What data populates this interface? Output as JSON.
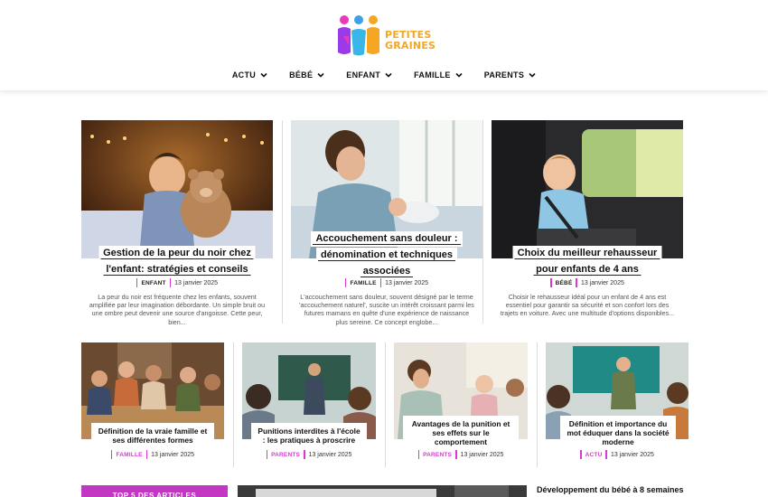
{
  "brand": {
    "line1": "PETITES",
    "line2": "GRAINES"
  },
  "nav": [
    {
      "label": "ACTU"
    },
    {
      "label": "BÉBÉ"
    },
    {
      "label": "ENFANT"
    },
    {
      "label": "FAMILLE"
    },
    {
      "label": "PARENTS"
    }
  ],
  "featured": [
    {
      "title": "Gestion de la peur du noir chez l'enfant: stratégies et conseils",
      "category": "ENFANT",
      "date": "13 janvier 2025",
      "excerpt": "La peur du noir est fréquente chez les enfants, souvent amplifiée par leur imagination débordante. Un simple bruit ou une ombre peut devenir une source d'angoisse. Cette peur, bien..."
    },
    {
      "title": "Accouchement sans douleur : dénomination et techniques associées",
      "category": "FAMILLE",
      "date": "13 janvier 2025",
      "excerpt": "L'accouchement sans douleur, souvent désigné par le terme 'accouchement naturel', suscite un intérêt croissant parmi les futures mamans en quête d'une expérience de naissance plus sereine. Ce concept englobe..."
    },
    {
      "title": "Choix du meilleur rehausseur pour enfants de 4 ans",
      "category": "BÉBÉ",
      "date": "13 janvier 2025",
      "excerpt": "Choisir le rehausseur idéal pour un enfant de 4 ans est essentiel pour garantir sa sécurité et son confort lors des trajets en voiture. Avec une multitude d'options disponibles..."
    }
  ],
  "secondary": [
    {
      "title": "Définition de la vraie famille et ses différentes formes",
      "category": "FAMILLE",
      "date": "13 janvier 2025"
    },
    {
      "title": "Punitions interdites à l'école : les pratiques à proscrire",
      "category": "PARENTS",
      "date": "13 janvier 2025"
    },
    {
      "title": "Avantages de la punition et ses effets sur le comportement",
      "category": "PARENTS",
      "date": "13 janvier 2025"
    },
    {
      "title": "Définition et importance du mot éduquer dans la société moderne",
      "category": "ACTU",
      "date": "13 janvier 2025"
    }
  ],
  "bottom": {
    "top_articles_label": "TOP 5 DES ARTICLES",
    "side_title": "Développement du bébé à 8 semaines"
  },
  "colors": {
    "accent": "#c238c2",
    "category_bar": "#d63ad0",
    "logo_orange": "#f5a623"
  },
  "icons": {
    "nav_chevron": "chevron-down-icon"
  }
}
